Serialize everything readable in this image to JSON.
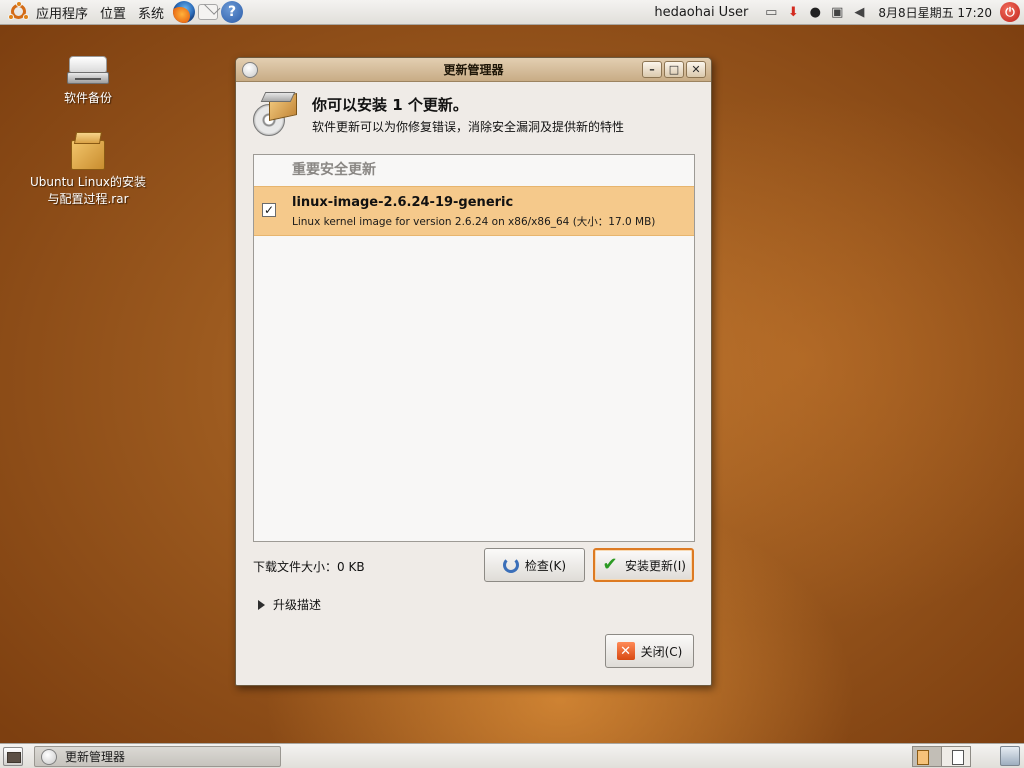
{
  "top_panel": {
    "menus": [
      "应用程序",
      "位置",
      "系统"
    ],
    "user": "hedaohai User",
    "clock": "8月8日星期五  17:20"
  },
  "desktop": {
    "icons": [
      {
        "label": "软件备份",
        "icon": "drive-icon"
      },
      {
        "label": "Ubuntu Linux的安装与配置过程.rar",
        "icon": "archive-icon"
      }
    ]
  },
  "window": {
    "title": "更新管理器",
    "headline": "你可以安装 1 个更新。",
    "subline": "软件更新可以为你修复错误，消除安全漏洞及提供新的特性",
    "group_header": "重要安全更新",
    "update": {
      "checked": true,
      "name": "linux-image-2.6.24-19-generic",
      "description": "Linux kernel image for version 2.6.24 on x86/x86_64 (大小：17.0 MB)"
    },
    "download_size": "下载文件大小：0 KB",
    "check_button": "检查(K)",
    "install_button": "安装更新(I)",
    "expander_label": "升级描述",
    "close_button": "关闭(C)"
  },
  "bottom_panel": {
    "task_label": "更新管理器"
  },
  "colors": {
    "accent": "#dd7a22",
    "selected_row": "#f5c98b",
    "panel": "#e9e7e3"
  }
}
